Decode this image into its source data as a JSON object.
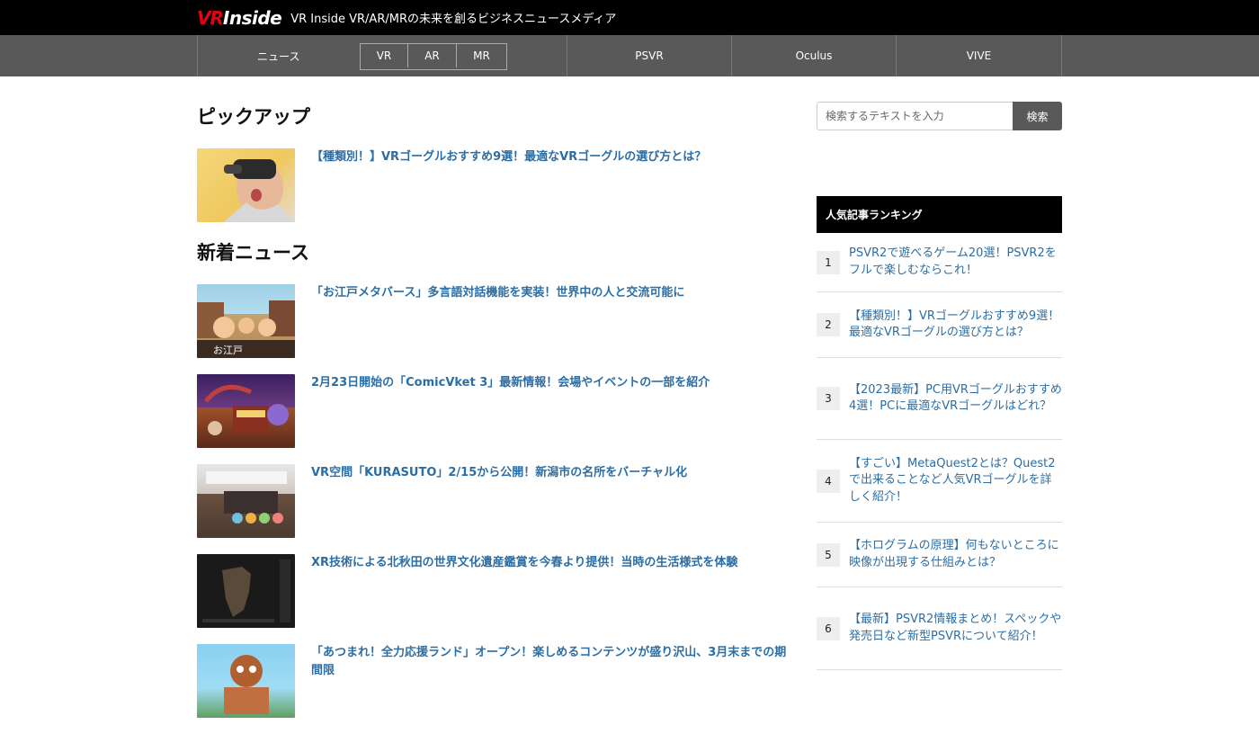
{
  "header": {
    "logo_vr": "VR",
    "logo_inside": "Inside",
    "tagline": "VR Inside VR/AR/MRの未来を創るビジネスニュースメディア"
  },
  "nav": {
    "news": "ニュース",
    "sub": [
      "VR",
      "AR",
      "MR"
    ],
    "psvr": "PSVR",
    "oculus": "Oculus",
    "vive": "VIVE"
  },
  "pickup": {
    "title": "ピックアップ",
    "articles": [
      {
        "title": "【種類別！】VRゴーグルおすすめ9選！最適なVRゴーグルの選び方とは？"
      }
    ]
  },
  "news": {
    "title": "新着ニュース",
    "articles": [
      {
        "title": "「お江戸メタバース」多言語対話機能を実装！世界中の人と交流可能に"
      },
      {
        "title": "2月23日開始の「ComicVket 3」最新情報！会場やイベントの一部を紹介"
      },
      {
        "title": "VR空間「KURASUTO」2/15から公開！新潟市の名所をバーチャル化"
      },
      {
        "title": "XR技術による北秋田の世界文化遺産鑑賞を今春より提供！当時の生活様式を体験"
      },
      {
        "title": "「あつまれ！全力応援ランド」オープン！楽しめるコンテンツが盛り沢山、3月末までの期間限"
      }
    ]
  },
  "search": {
    "placeholder": "検索するテキストを入力",
    "button": "検索"
  },
  "ranking": {
    "title": "人気記事ランキング",
    "items": [
      {
        "num": "1",
        "title": "PSVR2で遊べるゲーム20選！PSVR2をフルで楽しむならこれ！"
      },
      {
        "num": "2",
        "title": "【種類別！】VRゴーグルおすすめ9選！最適なVRゴーグルの選び方とは？"
      },
      {
        "num": "3",
        "title": "【2023最新】PC用VRゴーグルおすすめ4選！PCに最適なVRゴーグルはどれ？"
      },
      {
        "num": "4",
        "title": "【すごい】MetaQuest2とは？Quest2で出来ることなど人気VRゴーグルを詳しく紹介！"
      },
      {
        "num": "5",
        "title": "【ホログラムの原理】何もないところに映像が出現する仕組みとは？"
      },
      {
        "num": "6",
        "title": "【最新】PSVR2情報まとめ！スペックや発売日など新型PSVRについて紹介！"
      }
    ]
  }
}
